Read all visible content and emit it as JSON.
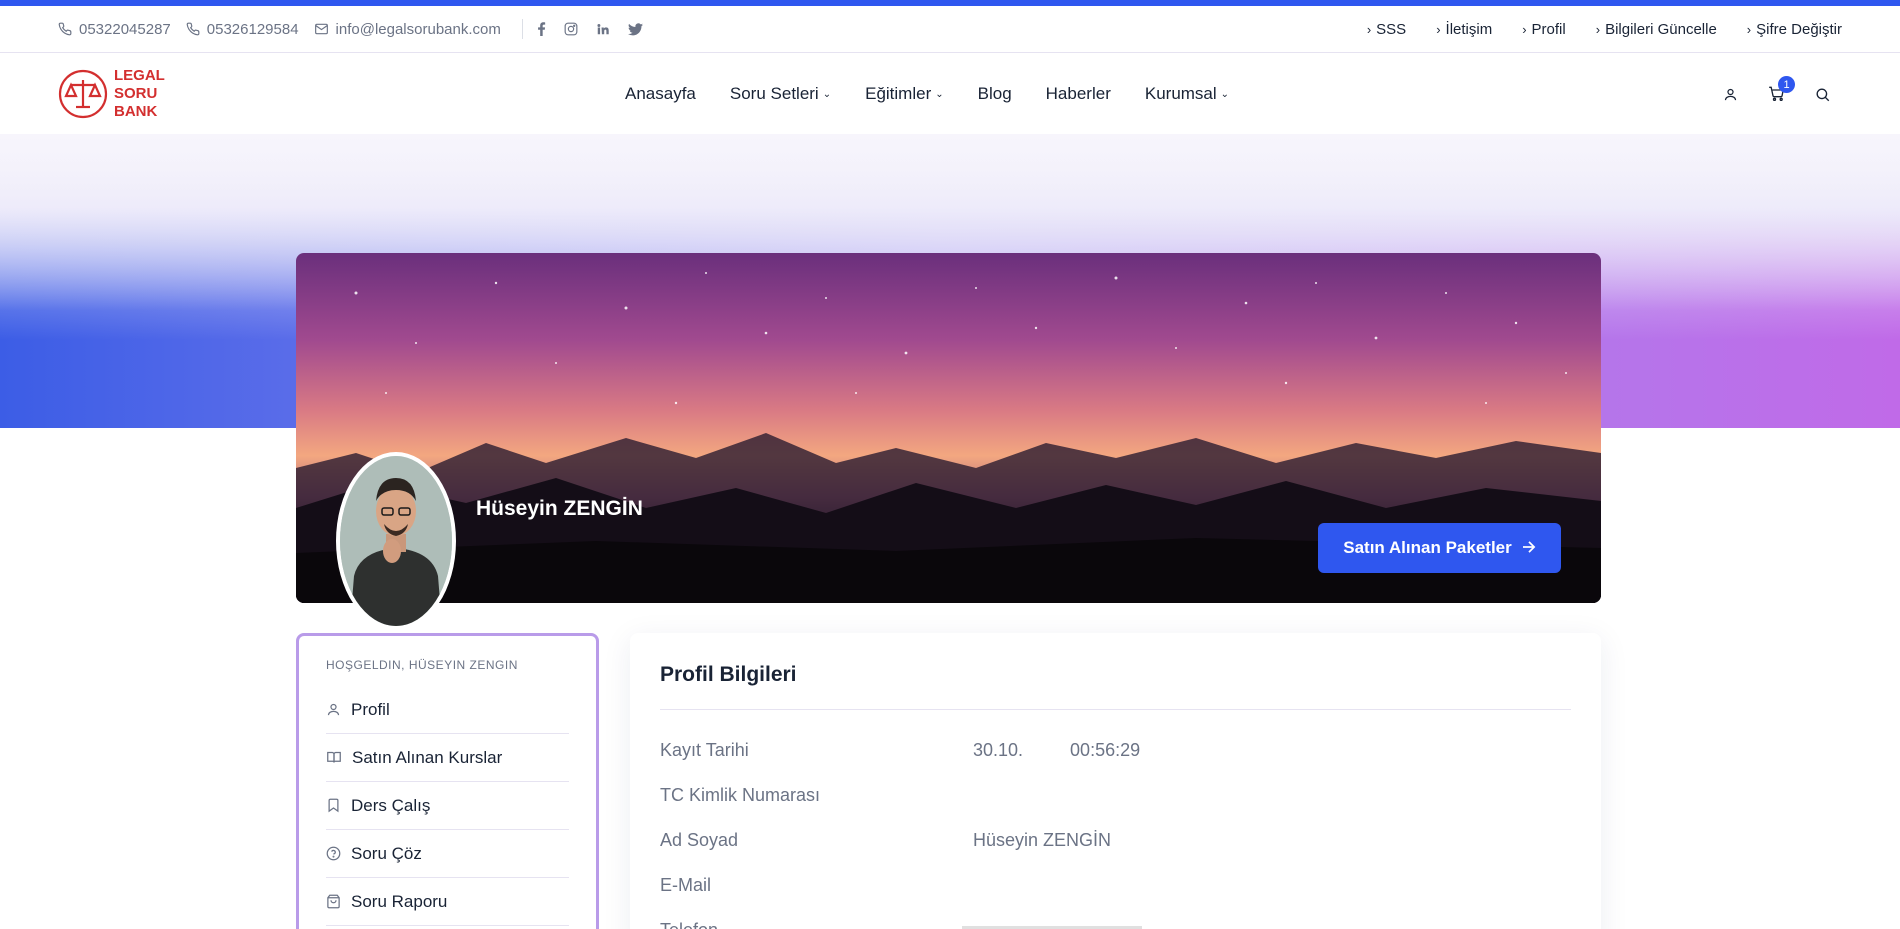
{
  "topbar": {
    "phone1": "05322045287",
    "phone2": "05326129584",
    "email": "info@legalsorubank.com",
    "social": [
      "facebook-icon",
      "instagram-icon",
      "linkedin-icon",
      "twitter-icon"
    ],
    "links": [
      "SSS",
      "İletişim",
      "Profil",
      "Bilgileri Güncelle",
      "Şifre Değiştir"
    ]
  },
  "header": {
    "logo_line1": "LEGAL",
    "logo_line2": "SORU",
    "logo_line3": "BANK",
    "nav": [
      "Anasayfa",
      "Soru Setleri",
      "Eğitimler",
      "Blog",
      "Haberler",
      "Kurumsal"
    ],
    "cart_count": "1"
  },
  "profile": {
    "name": "Hüseyin ZENGİN",
    "button_label": "Satın Alınan Paketler"
  },
  "sidebar": {
    "greeting": "HOŞGELDIN, HÜSEYIN ZENGIN",
    "items": [
      "Profil",
      "Satın Alınan Kurslar",
      "Ders Çalış",
      "Soru Çöz",
      "Soru Raporu"
    ]
  },
  "card": {
    "title": "Profil Bilgileri",
    "rows": [
      {
        "label": "Kayıt Tarihi",
        "value1": "30.10.",
        "value2": "00:56:29"
      },
      {
        "label": "TC Kimlik Numarası",
        "value1": "",
        "value2": ""
      },
      {
        "label": "Ad Soyad",
        "value1": "Hüseyin ZENGİN",
        "value2": ""
      },
      {
        "label": "E-Mail",
        "value1": "",
        "value2": ""
      },
      {
        "label": "Telefon",
        "value1": "",
        "value2": ""
      }
    ]
  },
  "colors": {
    "accent": "#2f57ef",
    "logo_red": "#d32f2f",
    "sidebar_border": "#b99be9"
  }
}
